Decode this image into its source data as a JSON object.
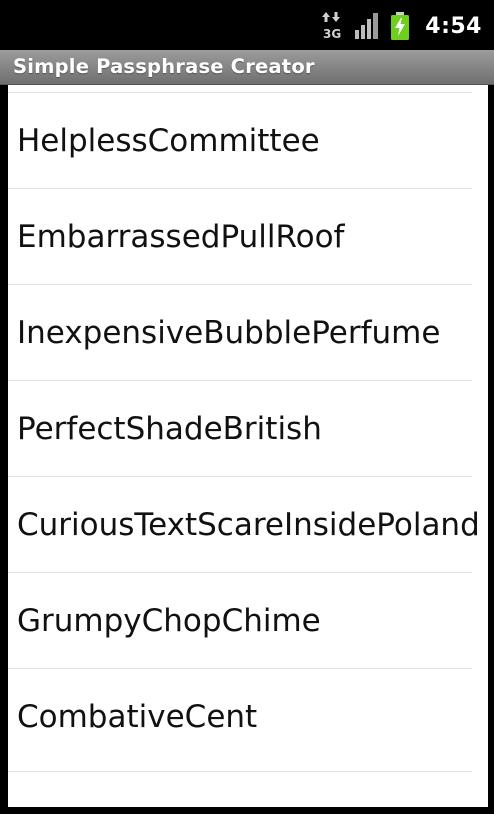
{
  "status_bar": {
    "network_type": "3G",
    "time": "4:54",
    "icons": [
      "data-arrows-icon",
      "signal-icon",
      "battery-charging-icon"
    ]
  },
  "app": {
    "title": "Simple Passphrase Creator"
  },
  "passphrases": [
    "HelplessCommittee",
    "EmbarrassedPullRoof",
    "InexpensiveBubblePerfume",
    "PerfectShadeBritish",
    "CuriousTextScareInsidePoland",
    "GrumpyChopChime",
    "CombativeCent"
  ],
  "colors": {
    "title_bar_top": "#9c9c9c",
    "title_bar_bottom": "#6f6f6f",
    "battery_green": "#6fcf1f"
  }
}
